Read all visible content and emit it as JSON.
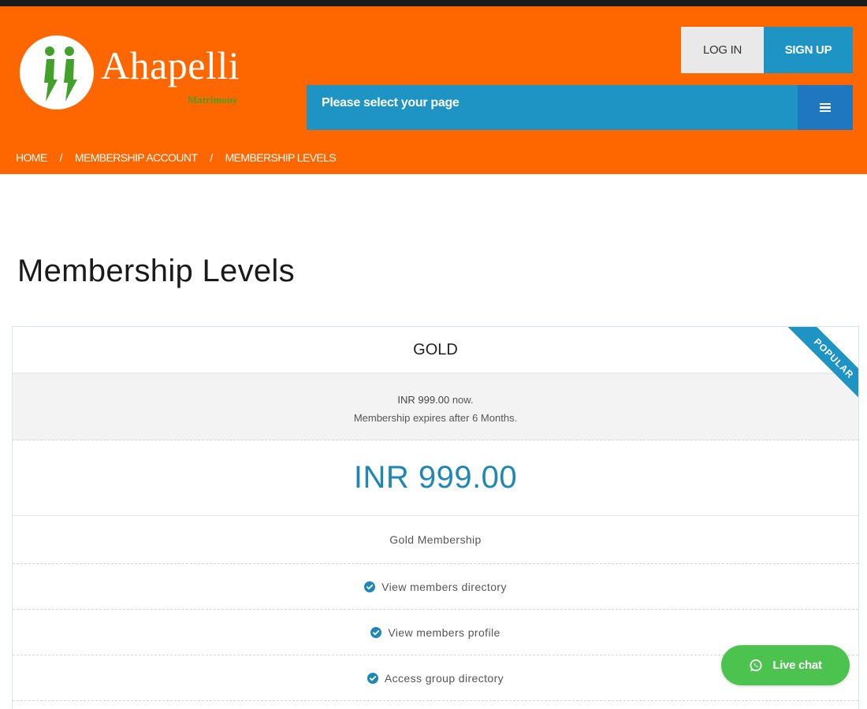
{
  "header": {
    "brand": "Ahapelli",
    "brand_sub": "Matrimony",
    "login_label": "LOG IN",
    "signup_label": "SIGN UP",
    "page_select_label": "Please select your page",
    "menu_icon": "hamburger-icon"
  },
  "breadcrumb": {
    "items": [
      "HOME",
      "MEMBERSHIP ACCOUNT",
      "MEMBERSHIP LEVELS"
    ],
    "separator": "/"
  },
  "main": {
    "title": "Membership Levels"
  },
  "plan": {
    "name": "GOLD",
    "ribbon": "POPULAR",
    "price_line_amount": "INR 999.00",
    "price_line_suffix": "now.",
    "expiry": "Membership expires after 6 Months.",
    "price": "INR 999.00",
    "description": "Gold Membership",
    "features": [
      "View members directory",
      "View members profile",
      "Access group directory"
    ],
    "feature_icon": "check-circle-icon"
  },
  "chat": {
    "label": "Live chat",
    "icon": "whatsapp-icon"
  },
  "colors": {
    "header_bg": "#fe6600",
    "accent_blue": "#1d94c4",
    "menu_blue": "#1f77c0",
    "logo_green": "#43a02a",
    "chat_green": "#4cc24f",
    "price_blue": "#1e87b5"
  }
}
